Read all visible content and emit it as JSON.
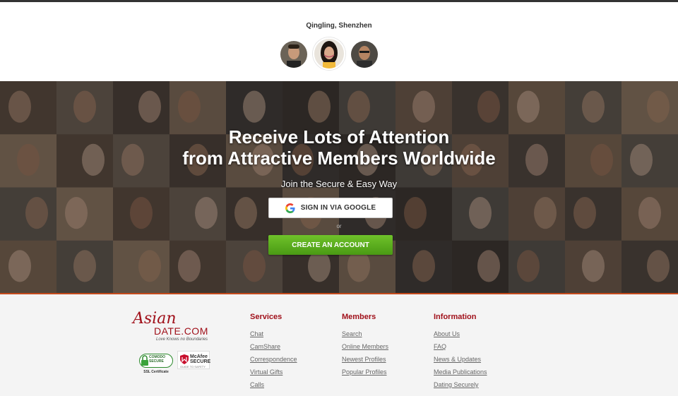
{
  "profile": {
    "name": "Qingling, Shenzhen"
  },
  "hero": {
    "title_line1": "Receive Lots of Attention",
    "title_line2": "from Attractive Members Worldwide",
    "subtitle": "Join the Secure & Easy Way",
    "google_button": "SIGN IN VIA GOOGLE",
    "or": "or",
    "create_button": "CREATE AN ACCOUNT"
  },
  "logo": {
    "asian": "Asian",
    "date": "DATE.COM",
    "tagline": "Love Knows no Boundaries"
  },
  "badges": {
    "comodo_top": "COMODO",
    "comodo_bottom": "SECURE",
    "ssl": "SSL Certificate",
    "mcafee_top": "McAfee",
    "mcafee_bottom": "SECURE",
    "mcafee_sub": "GUIDE TO SAFETY"
  },
  "footer": {
    "columns": [
      {
        "title": "Services",
        "links": [
          "Chat",
          "CamShare",
          "Correspondence",
          "Virtual Gifts",
          "Calls"
        ]
      },
      {
        "title": "Members",
        "links": [
          "Search",
          "Online Members",
          "Newest Profiles",
          "Popular Profiles"
        ]
      },
      {
        "title": "Information",
        "links": [
          "About Us",
          "FAQ",
          "News & Updates",
          "Media Publications",
          "Dating Securely"
        ]
      }
    ]
  },
  "colors": {
    "brand_red": "#a0101a",
    "cta_green": "#5cae1f",
    "hero_border": "#c44a1c"
  }
}
